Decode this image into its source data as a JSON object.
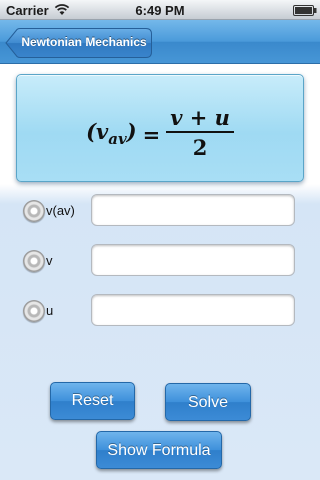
{
  "status_bar": {
    "carrier": "Carrier",
    "time": "6:49 PM",
    "wifi_icon": "wifi-icon",
    "battery_icon": "battery-full-icon"
  },
  "nav_bar": {
    "back_label": "Newtonian Mechanics",
    "accent_color": "#4a9ada"
  },
  "formula": {
    "lhs_var": "(v",
    "lhs_sub": "av",
    "lhs_close": ")",
    "equals": "=",
    "numerator": "v + u",
    "denominator": "2"
  },
  "variables": [
    {
      "label": "v(av)",
      "value": "",
      "selected": false
    },
    {
      "label": "v",
      "value": "",
      "selected": false
    },
    {
      "label": "u",
      "value": "",
      "selected": false
    }
  ],
  "buttons": {
    "reset": "Reset",
    "solve": "Solve",
    "show_formula": "Show Formula"
  }
}
